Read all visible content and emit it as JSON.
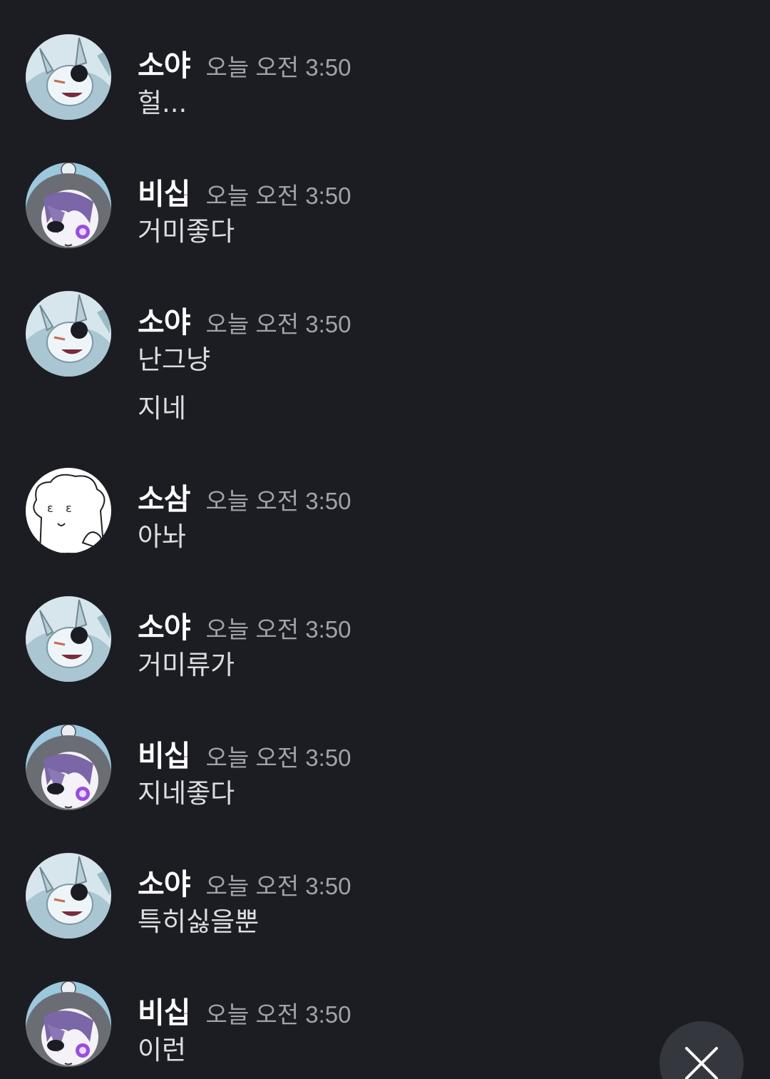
{
  "messages": [
    {
      "author": "소야",
      "avatar": "wolf-avatar",
      "time": "오늘 오전 3:50",
      "lines": [
        "헐..."
      ]
    },
    {
      "author": "비십",
      "avatar": "purple-hair-avatar",
      "time": "오늘 오전 3:50",
      "lines": [
        "거미좋다"
      ]
    },
    {
      "author": "소야",
      "avatar": "wolf-avatar",
      "time": "오늘 오전 3:50",
      "lines": [
        "난그냥",
        "지네"
      ]
    },
    {
      "author": "소삼",
      "avatar": "dog-sketch-avatar",
      "time": "오늘 오전 3:50",
      "lines": [
        "아놔"
      ]
    },
    {
      "author": "소야",
      "avatar": "wolf-avatar",
      "time": "오늘 오전 3:50",
      "lines": [
        "거미류가"
      ]
    },
    {
      "author": "비십",
      "avatar": "purple-hair-avatar",
      "time": "오늘 오전 3:50",
      "lines": [
        "지네좋다"
      ]
    },
    {
      "author": "소야",
      "avatar": "wolf-avatar",
      "time": "오늘 오전 3:50",
      "lines": [
        "특히싫을뿐"
      ]
    },
    {
      "author": "비십",
      "avatar": "purple-hair-avatar",
      "time": "오늘 오전 3:50",
      "lines": [
        "이런"
      ]
    }
  ],
  "close_button": {
    "icon": "close-icon"
  },
  "colors": {
    "background": "#1c1d23",
    "username": "#ffffff",
    "timestamp": "#a1a3ab",
    "message": "#dbdee1",
    "close_button_bg": "#35373e"
  }
}
